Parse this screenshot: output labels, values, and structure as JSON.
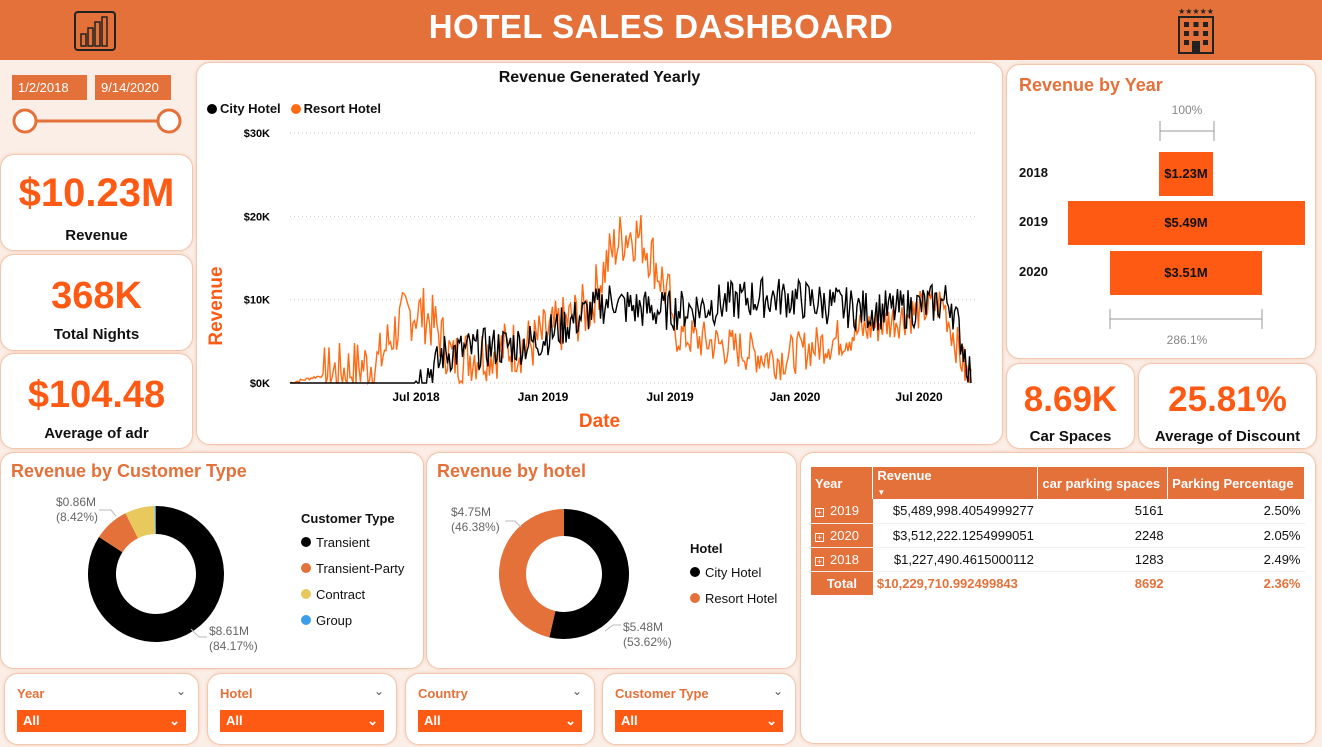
{
  "header": {
    "title": "HOTEL SALES DASHBOARD",
    "left_icon": "power-bi-icon",
    "right_icon": "hotel-icon"
  },
  "date_range": {
    "start": "1/2/2018",
    "end": "9/14/2020"
  },
  "kpis": {
    "revenue": {
      "value": "$10.23M",
      "label": "Revenue"
    },
    "total_nights": {
      "value": "368K",
      "label": "Total Nights"
    },
    "adr": {
      "value": "$104.48",
      "label": "Average of adr"
    },
    "car_spaces": {
      "value": "8.69K",
      "label": "Car Spaces"
    },
    "discount": {
      "value": "25.81%",
      "label": "Average of Discount"
    }
  },
  "colors": {
    "accent": "#e4703a",
    "bright": "#ff5a14",
    "city": "#000000",
    "resort": "#ff6a14"
  },
  "line_chart": {
    "title": "Revenue Generated Yearly",
    "legend": [
      "City Hotel",
      "Resort Hotel"
    ],
    "ylabel": "Revenue",
    "xlabel": "Date",
    "yticks": [
      "$0K",
      "$10K",
      "$20K",
      "$30K"
    ],
    "xticks": [
      "Jul 2018",
      "Jan 2019",
      "Jul 2019",
      "Jan 2020",
      "Jul 2020"
    ]
  },
  "revenue_by_year": {
    "title": "Revenue by Year",
    "top_pct": "100%",
    "bottom_pct": "286.1%",
    "bars": [
      {
        "year": "2018",
        "label": "$1.23M",
        "value": 1.23
      },
      {
        "year": "2019",
        "label": "$5.49M",
        "value": 5.49
      },
      {
        "year": "2020",
        "label": "$3.51M",
        "value": 3.51
      }
    ]
  },
  "customer_type": {
    "title": "Revenue by Customer Type",
    "legend_title": "Customer Type",
    "items": [
      {
        "name": "Transient",
        "color": "#000000",
        "value": 84.17
      },
      {
        "name": "Transient-Party",
        "color": "#e4703a",
        "value": 8.42
      },
      {
        "name": "Contract",
        "color": "#e8c95e",
        "value": 7.1
      },
      {
        "name": "Group",
        "color": "#3c9ee8",
        "value": 0.31
      }
    ],
    "label_small_value": "$0.86M",
    "label_small_pct": "(8.42%)",
    "label_big_value": "$8.61M",
    "label_big_pct": "(84.17%)"
  },
  "by_hotel": {
    "title": "Revenue by hotel",
    "legend_title": "Hotel",
    "items": [
      {
        "name": "City Hotel",
        "color": "#000000",
        "value": 53.62
      },
      {
        "name": "Resort Hotel",
        "color": "#e4703a",
        "value": 46.38
      }
    ],
    "label_resort_value": "$4.75M",
    "label_resort_pct": "(46.38%)",
    "label_city_value": "$5.48M",
    "label_city_pct": "(53.62%)"
  },
  "table": {
    "headers": [
      "Year",
      "Revenue",
      "car parking spaces",
      "Parking Percentage"
    ],
    "rows": [
      {
        "year": "2019",
        "revenue": "$5,489,998.4054999277",
        "parking": "5161",
        "pct": "2.50%"
      },
      {
        "year": "2020",
        "revenue": "$3,512,222.1254999051",
        "parking": "2248",
        "pct": "2.05%"
      },
      {
        "year": "2018",
        "revenue": "$1,227,490.4615000112",
        "parking": "1283",
        "pct": "2.49%"
      }
    ],
    "total": {
      "label": "Total",
      "revenue": "$10,229,710.992499843",
      "parking": "8692",
      "pct": "2.36%"
    }
  },
  "slicers": [
    {
      "label": "Year",
      "value": "All"
    },
    {
      "label": "Hotel",
      "value": "All"
    },
    {
      "label": "Country",
      "value": "All"
    },
    {
      "label": "Customer Type",
      "value": "All"
    }
  ]
}
